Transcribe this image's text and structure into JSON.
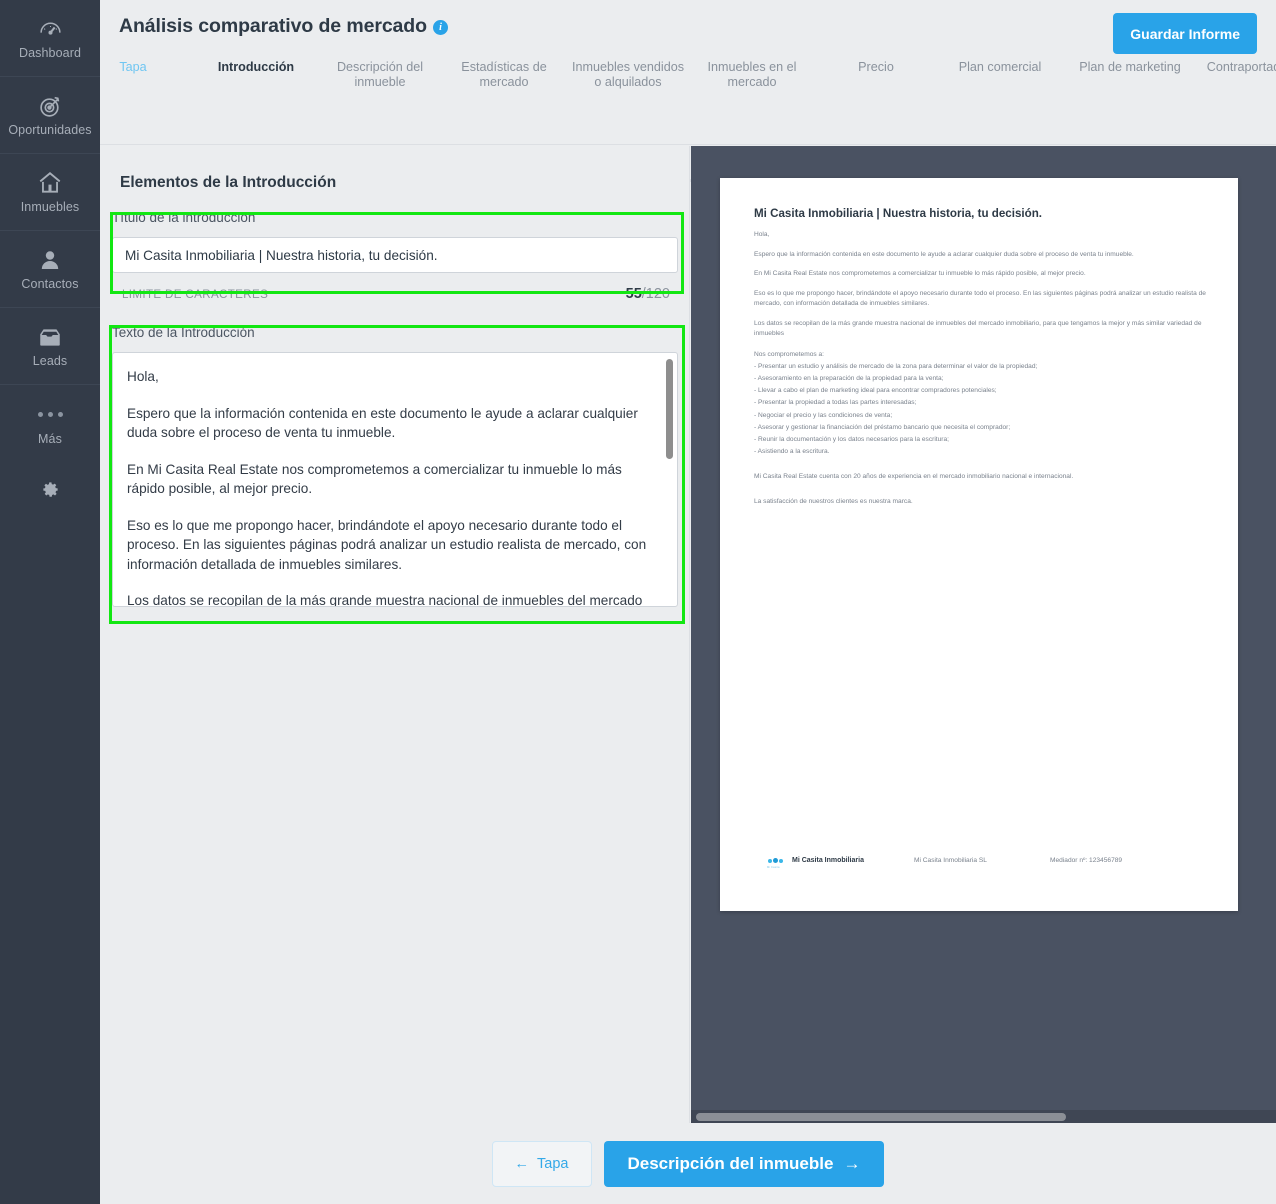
{
  "sidebar": {
    "items": [
      {
        "label": "Dashboard",
        "icon": "gauge-icon"
      },
      {
        "label": "Oportunidades",
        "icon": "target-icon"
      },
      {
        "label": "Inmuebles",
        "icon": "house-icon"
      },
      {
        "label": "Contactos",
        "icon": "person-icon"
      },
      {
        "label": "Leads",
        "icon": "inbox-icon"
      },
      {
        "label": "Más",
        "icon": "ellipsis-icon"
      }
    ],
    "settings_icon": "gear-icon"
  },
  "header": {
    "title": "Análisis comparativo de mercado",
    "info_icon": "info-icon",
    "save_label": "Guardar Informe",
    "accent_color": "#29a3e8"
  },
  "stepper": {
    "steps": [
      {
        "label": "Tapa",
        "state": "done"
      },
      {
        "label": "Introducción",
        "state": "current"
      },
      {
        "label": "Descripción del inmueble",
        "state": "pending"
      },
      {
        "label": "Estadísticas de mercado",
        "state": "pending"
      },
      {
        "label": "Inmuebles vendidos o alquilados",
        "state": "pending"
      },
      {
        "label": "Inmuebles en el mercado",
        "state": "pending"
      },
      {
        "label": "Precio",
        "state": "pending"
      },
      {
        "label": "Plan comercial",
        "state": "pending"
      },
      {
        "label": "Plan de marketing",
        "state": "pending"
      },
      {
        "label": "Contraportada",
        "state": "pending"
      }
    ]
  },
  "form": {
    "section_title": "Elementos de la Introducción",
    "title_label": "Título de la introducción",
    "title_value": "Mi Casita Inmobiliaria | Nuestra historia, tu decisión.",
    "charlimit_label": "LIMITE DE CARACTERES",
    "charlimit_used": "55",
    "charlimit_max": "/120",
    "text_label": "Texto de la Introducción",
    "text_paragraphs": [
      "Hola,",
      "Espero que la información contenida en este documento le ayude a aclarar cualquier duda sobre el proceso de venta tu inmueble.",
      "En Mi Casita Real Estate nos comprometemos a comercializar tu inmueble lo más rápido posible, al mejor precio.",
      "Eso es lo que me propongo hacer, brindándote el apoyo necesario durante todo el proceso. En las siguientes páginas podrá analizar un estudio realista de mercado, con información detallada de inmuebles similares.",
      "Los datos se recopilan de la más grande muestra nacional de inmuebles del mercado inmobiliario, para que tengamos la mejor y más similar variedad de inmuebles"
    ]
  },
  "preview": {
    "doc_title": "Mi Casita Inmobiliaria | Nuestra historia, tu decisión.",
    "paragraphs": [
      "Hola,",
      "Espero que la información contenida en este documento le ayude a aclarar cualquier duda sobre el proceso de venta tu inmueble.",
      "En Mi Casita Real Estate nos comprometemos a comercializar tu inmueble lo más rápido posible, al mejor precio.",
      "Eso es lo que me propongo hacer, brindándote el apoyo necesario durante todo el proceso. En las siguientes páginas podrá analizar un estudio realista de mercado, con información detallada de inmuebles similares.",
      "Los datos se recopilan de la más grande muestra nacional de inmuebles del mercado inmobiliario, para que tengamos la mejor y más similar variedad de inmuebles"
    ],
    "commitments_intro": "Nos comprometemos a:",
    "commitments": [
      "- Presentar un estudio y análisis de mercado de la zona para determinar el valor de la propiedad;",
      "- Asesoramiento en la preparación de la propiedad para la venta;",
      "- Llevar a cabo el plan de marketing ideal para encontrar compradores potenciales;",
      "- Presentar la propiedad a todas las partes interesadas;",
      "- Negociar el precio y las condiciones de venta;",
      "- Asesorar y gestionar la financiación del préstamo bancario que necesita el comprador;",
      "- Reunir la documentación y los datos necesarios para la escritura;",
      "- Asistiendo a la escritura."
    ],
    "closing_paragraphs": [
      "Mi Casita Real Estate cuenta con 20 años de experiencia en el mercado inmobiliario nacional e internacional.",
      "La satisfacción de nuestros clientes es nuestra marca."
    ],
    "footer": {
      "brand": "Mi Casita Inmobiliaria",
      "company": "Mi Casita Inmobiliaria SL",
      "mediator": "Mediador nº: 123456789",
      "logo_icon": "mi-casita-logo-icon"
    }
  },
  "footer_nav": {
    "back_label": "Tapa",
    "back_icon": "arrow-left-icon",
    "next_label": "Descripción del inmueble",
    "next_icon": "arrow-right-icon"
  }
}
